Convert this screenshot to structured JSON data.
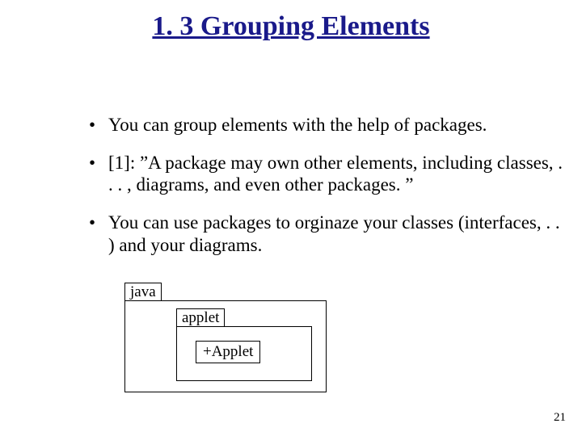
{
  "title": "1. 3 Grouping Elements",
  "bullets": [
    "You can group elements with the help of packages.",
    "[1]: ”A package may own other elements, including classes, . . . , diagrams, and even other packages. ”",
    "You can use packages to orginaze your classes (interfaces, . . ) and your diagrams."
  ],
  "diagram": {
    "outer_package": "java",
    "inner_package": "applet",
    "class_name": "+Applet"
  },
  "page_number": "21"
}
